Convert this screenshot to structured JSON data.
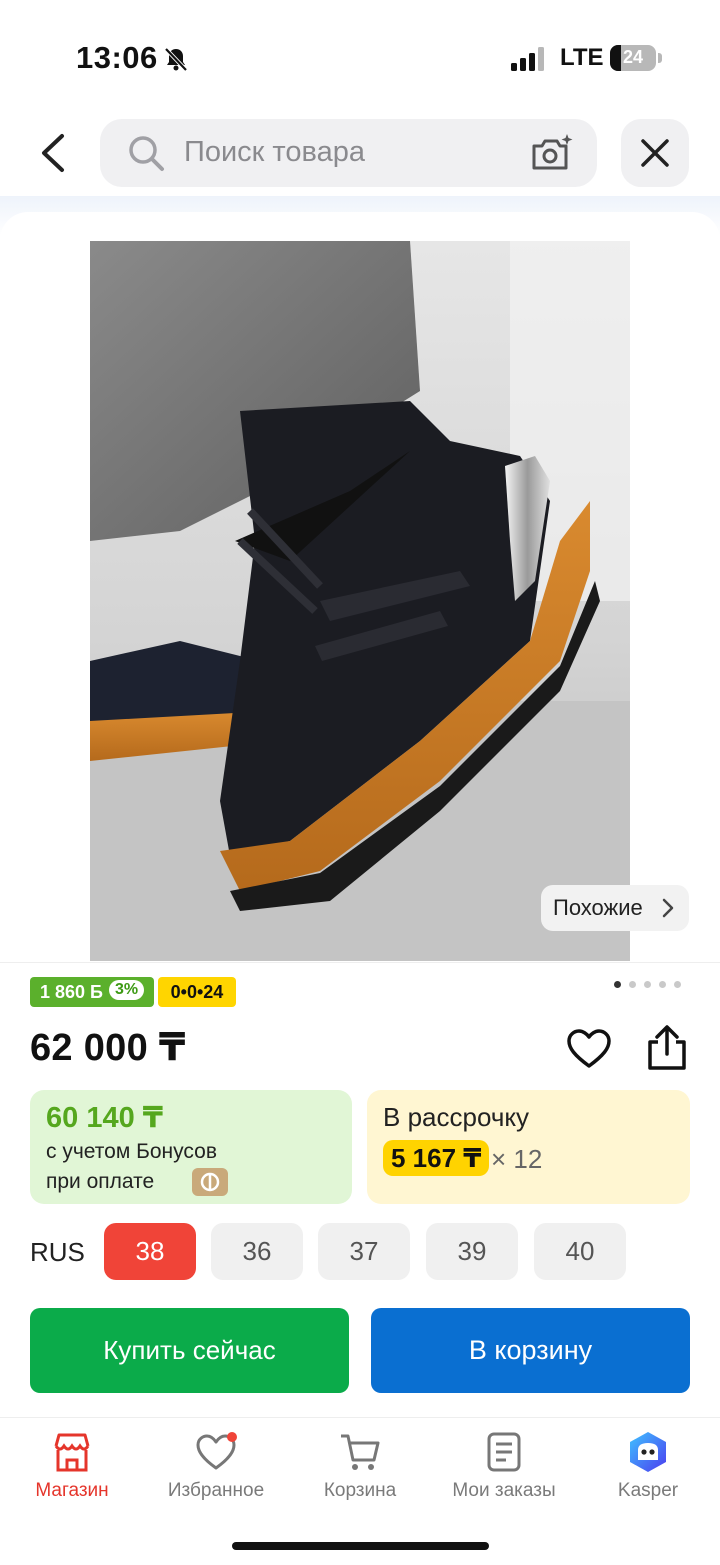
{
  "status_bar": {
    "time": "13:06",
    "network": "LTE",
    "battery": "24",
    "battery_level": 0.24
  },
  "search": {
    "placeholder": "Поиск товара"
  },
  "product": {
    "similar_label": "Похожие",
    "bonus_points": "1 860 Б",
    "bonus_percent": "3%",
    "code_badge": "0•0•24",
    "image_count": 5,
    "current_image": 1,
    "price": "62 000 ₸",
    "bonus_price": "60 140 ₸",
    "bonus_line1": "с учетом Бонусов",
    "bonus_line2": "при оплате",
    "installment_title": "В рассрочку",
    "installment_amount": "5 167 ₸",
    "installment_multiplier": "× 12"
  },
  "sizes": {
    "system": "RUS",
    "options": [
      "38",
      "36",
      "37",
      "39",
      "40"
    ],
    "selected": "38"
  },
  "actions": {
    "buy_now": "Купить сейчас",
    "add_to_cart": "В корзину"
  },
  "tabbar": {
    "items": [
      {
        "label": "Магазин",
        "icon": "store-icon",
        "active": true
      },
      {
        "label": "Избранное",
        "icon": "heart-icon",
        "badge": true
      },
      {
        "label": "Корзина",
        "icon": "cart-icon"
      },
      {
        "label": "Мои заказы",
        "icon": "orders-icon"
      },
      {
        "label": "Kasper",
        "icon": "kasper-assistant-icon"
      }
    ]
  },
  "colors": {
    "brand_red": "#f04438",
    "buy_green": "#0bab4a",
    "cart_blue": "#0a6fd1",
    "bonus_green": "#5bb02c",
    "accent_yellow": "#ffd500"
  }
}
